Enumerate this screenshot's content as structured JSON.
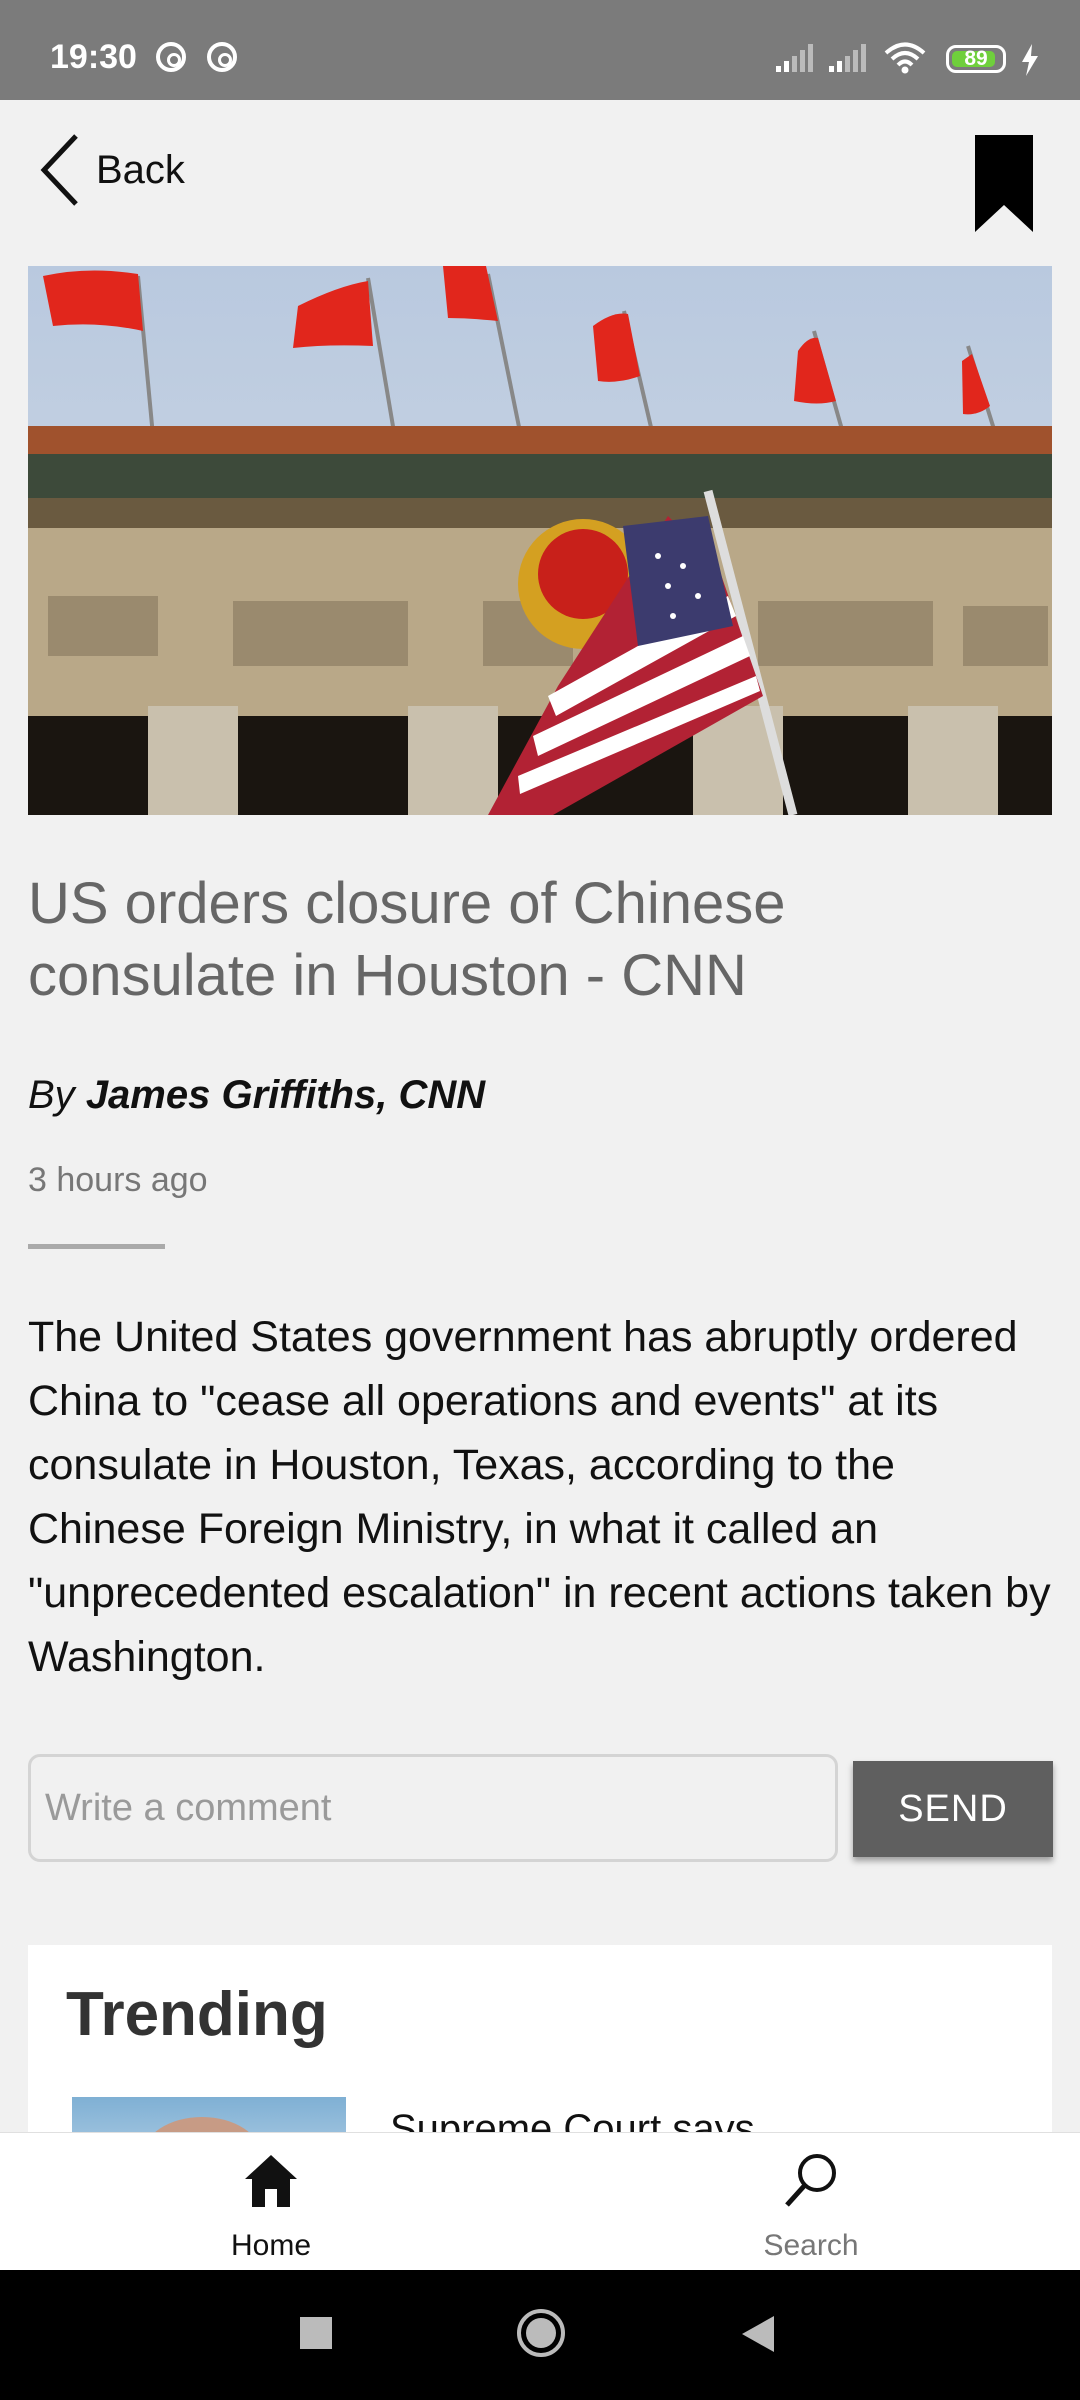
{
  "status_bar": {
    "time": "19:30",
    "battery_level": "89",
    "battery_fraction": 0.89,
    "battery_color": "#6fcf3c",
    "icons": [
      "at-sign-icon",
      "at-sign-icon",
      "signal-icon",
      "signal-icon",
      "wifi-icon",
      "battery-icon",
      "charging-icon"
    ]
  },
  "top_bar": {
    "back_label": "Back",
    "back_icon": "chevron-left-icon",
    "bookmark_icon": "bookmark-icon"
  },
  "article": {
    "image_alt": "Chinese flags and US flag outside the Great Hall",
    "headline": "US orders closure of Chinese consulate in Houston - CNN",
    "byline_prefix": "By",
    "author": "James Griffiths, CNN",
    "time_ago": "3 hours ago",
    "body": "The United States government has abruptly ordered China to \"cease all operations and events\" at its consulate in Houston, Texas, according to the Chinese Foreign Ministry, in what it called an \"unprecedented escalation\" in recent actions taken by Washington."
  },
  "comment": {
    "placeholder": "Write a comment",
    "value": "",
    "send_label": "SEND"
  },
  "trending": {
    "title": "Trending",
    "items": [
      {
        "title": "Supreme Court says"
      }
    ]
  },
  "bottom_nav": {
    "items": [
      {
        "label": "Home",
        "icon": "home-icon",
        "active": true
      },
      {
        "label": "Search",
        "icon": "search-icon",
        "active": false
      }
    ]
  },
  "system_nav": {
    "icons": [
      "recents-square-icon",
      "home-circle-icon",
      "back-triangle-icon"
    ]
  }
}
